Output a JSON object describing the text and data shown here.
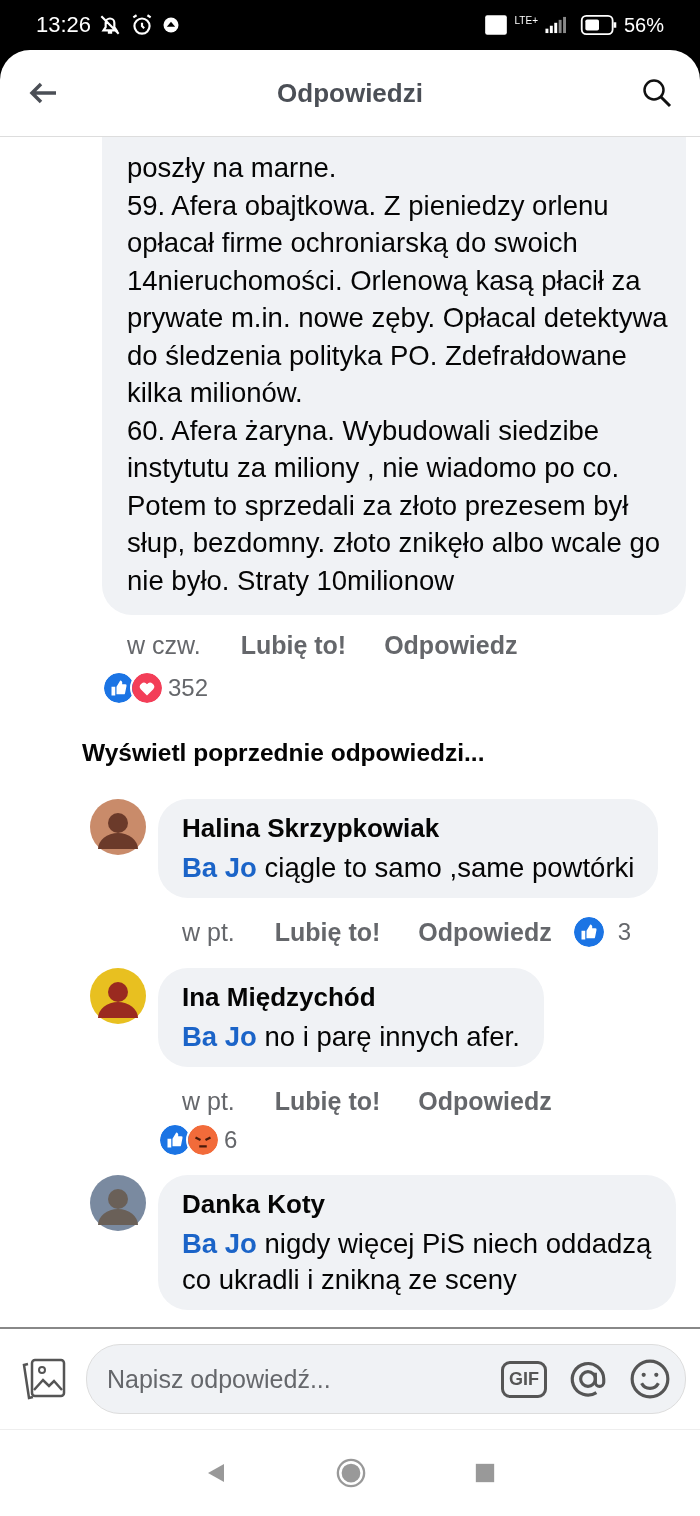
{
  "status_bar": {
    "time": "13:26",
    "network": "LTE+",
    "battery": "56%"
  },
  "header": {
    "title": "Odpowiedzi"
  },
  "main_comment": {
    "paragraphs": [
      "poszły na marne.",
      "59. Afera obajtkowa. Z pieniedzy orlenu opłacał firme ochroniarską do swoich 14nieruchomości. Orlenową kasą płacił za prywate m.in. nowe zęby. Opłacal detektywa do śledzenia polityka PO. Zdefrałdowane kilka milionów.",
      "60. Afera żaryna. Wybudowali siedzibe instytutu za miliony , nie wiadomo po co. Potem to sprzedali za złoto prezesem był słup, bezdomny. złoto znikęło albo wcale go nie było. Straty 10milionow"
    ],
    "time": "w czw.",
    "like": "Lubię to!",
    "reply": "Odpowiedz",
    "reactions": {
      "icons": [
        {
          "kind": "like"
        },
        {
          "kind": "love"
        }
      ],
      "count": "352"
    }
  },
  "previous_link": "Wyświetl poprzednie odpowiedzi...",
  "replies": [
    {
      "name": "Halina Skrzypkowiak",
      "mention": "Ba Jo",
      "text": "ciągle to samo ,same powtórki",
      "time": "w pt.",
      "like": "Lubię to!",
      "reply": "Odpowiedz",
      "inline_reactions": {
        "icons": [
          {
            "kind": "like"
          }
        ],
        "count": "3"
      }
    },
    {
      "name": "Ina Międzychód",
      "mention": "Ba Jo",
      "text": "no i parę innych afer.",
      "time": "w pt.",
      "like": "Lubię to!",
      "reply": "Odpowiedz",
      "reactions": {
        "icons": [
          {
            "kind": "like"
          },
          {
            "kind": "angry"
          }
        ],
        "count": "6"
      }
    },
    {
      "name": "Danka Koty",
      "mention": "Ba Jo",
      "text": "nigdy więcej PiS niech oddadzą co ukradli i znikną ze sceny"
    }
  ],
  "composer": {
    "placeholder": "Napisz odpowiedź...",
    "gif": "GIF"
  }
}
